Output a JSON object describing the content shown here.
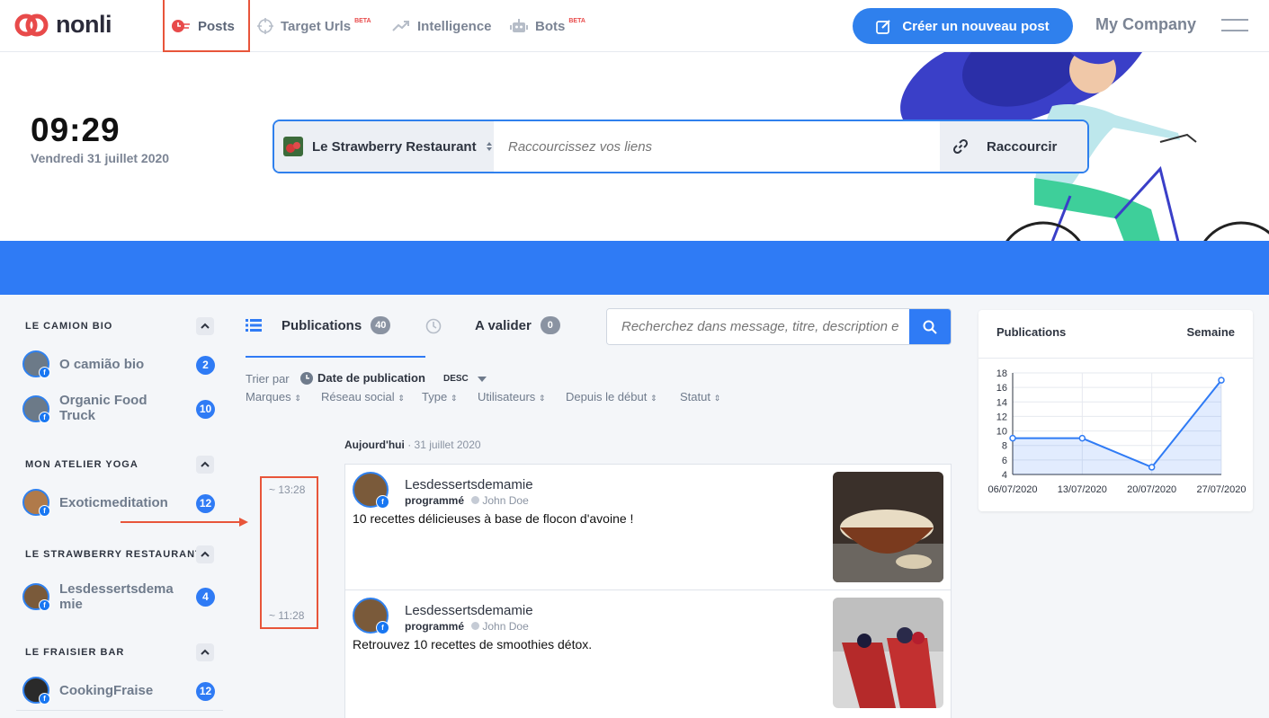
{
  "nav": {
    "logo": "nonli",
    "items": [
      {
        "label": "Posts",
        "icon": "posts-clock-icon"
      },
      {
        "label": "Target Urls",
        "badge": "BETA",
        "icon": "crosshair-icon"
      },
      {
        "label": "Intelligence",
        "icon": "trend-up-icon"
      },
      {
        "label": "Bots",
        "badge": "BETA",
        "icon": "robot-icon"
      }
    ],
    "create_label": "Créer un nouveau post",
    "company": "My Company"
  },
  "hero": {
    "time": "09:29",
    "date": "Vendredi 31 juillet 2020",
    "brand_select": "Le Strawberry Restaurant",
    "url_placeholder": "Raccourcissez vos liens",
    "shorten_label": "Raccourcir"
  },
  "sidebar": {
    "groups": [
      {
        "title": "LE CAMION BIO",
        "items": [
          {
            "label": "O camião bio",
            "count": "2"
          },
          {
            "label": "Organic Food Truck",
            "count": "10"
          }
        ]
      },
      {
        "title": "MON ATELIER YOGA",
        "items": [
          {
            "label": "Exoticmeditation",
            "count": "12"
          }
        ]
      },
      {
        "title": "LE STRAWBERRY RESTAURANT",
        "items": [
          {
            "label": "Lesdessertsdemamie",
            "count": "4"
          }
        ]
      },
      {
        "title": "LE FRAISIER BAR",
        "items": [
          {
            "label": "CookingFraise",
            "count": "12"
          }
        ]
      }
    ]
  },
  "tabs": {
    "publications": {
      "label": "Publications",
      "count": "40"
    },
    "validate": {
      "label": "A valider",
      "count": "0"
    },
    "search_placeholder": "Recherchez dans message, titre, description e"
  },
  "filters": {
    "sort_by": "Trier par",
    "sort_field": "Date de publication",
    "order": "DESC",
    "items": [
      "Marques",
      "Réseau social",
      "Type",
      "Utilisateurs",
      "Depuis le début",
      "Statut"
    ]
  },
  "feed": {
    "day": "Aujourd'hui",
    "day_date": "· 31 juillet 2020",
    "posts": [
      {
        "time": "~ 13:28",
        "author": "Lesdessertsdemamie",
        "status": "programmé",
        "user": "John Doe",
        "message": "10 recettes délicieuses à base de flocon d'avoine !"
      },
      {
        "time": "~ 11:28",
        "author": "Lesdessertsdemamie",
        "status": "programmé",
        "user": "John Doe",
        "message": "Retrouvez 10 recettes de smoothies détox."
      }
    ]
  },
  "stats": {
    "title": "Publications",
    "scope": "Semaine"
  },
  "chart_data": {
    "type": "area",
    "categories": [
      "06/07/2020",
      "13/07/2020",
      "20/07/2020",
      "27/07/2020"
    ],
    "series": [
      {
        "values": [
          9,
          9,
          5,
          17
        ]
      }
    ],
    "ylim": [
      4,
      18
    ],
    "yticks": [
      4,
      6,
      8,
      10,
      12,
      14,
      16,
      18
    ],
    "grid": true,
    "color": "#2f7bf5"
  },
  "colors": {
    "accent": "#2f7bf5",
    "annotation": "#e8553a",
    "brand_red": "#e84a4a"
  }
}
